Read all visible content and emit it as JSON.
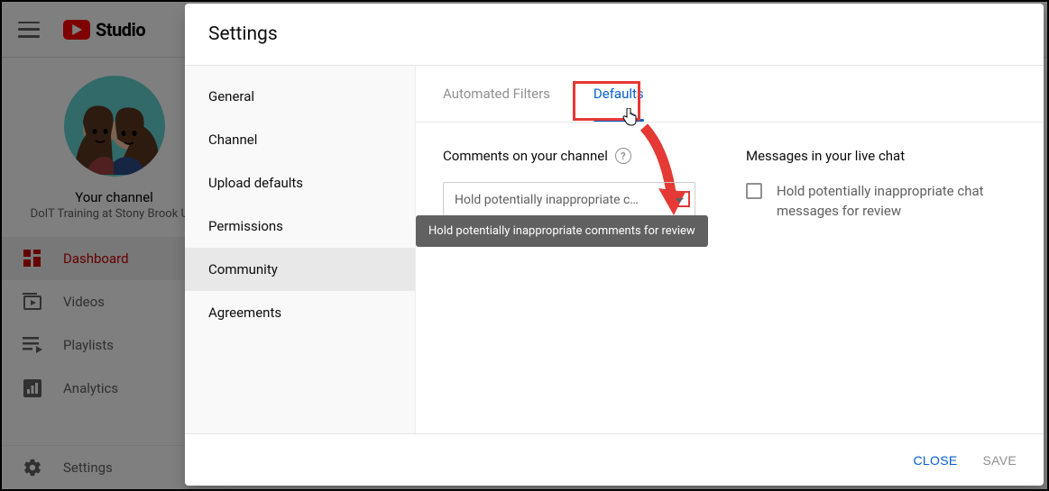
{
  "header": {
    "brand": "Studio"
  },
  "sidebar": {
    "your_channel": "Your channel",
    "channel_name": "DoIT Training at Stony Brook Uni",
    "items": [
      {
        "label": "Dashboard",
        "active": true
      },
      {
        "label": "Videos"
      },
      {
        "label": "Playlists"
      },
      {
        "label": "Analytics"
      }
    ],
    "bottom": {
      "label": "Settings"
    }
  },
  "modal": {
    "title": "Settings",
    "nav": [
      {
        "label": "General"
      },
      {
        "label": "Channel"
      },
      {
        "label": "Upload defaults"
      },
      {
        "label": "Permissions"
      },
      {
        "label": "Community",
        "active": true
      },
      {
        "label": "Agreements"
      }
    ],
    "tabs": {
      "automated": "Automated Filters",
      "defaults": "Defaults"
    },
    "comments": {
      "title": "Comments on your channel",
      "dropdown_value": "Hold potentially inappropriate c…",
      "tooltip": "Hold potentially inappropriate comments for review"
    },
    "messages": {
      "title": "Messages in your live chat",
      "checkbox_label": "Hold potentially inappropriate chat messages for review"
    },
    "footer": {
      "close": "CLOSE",
      "save": "SAVE"
    }
  }
}
